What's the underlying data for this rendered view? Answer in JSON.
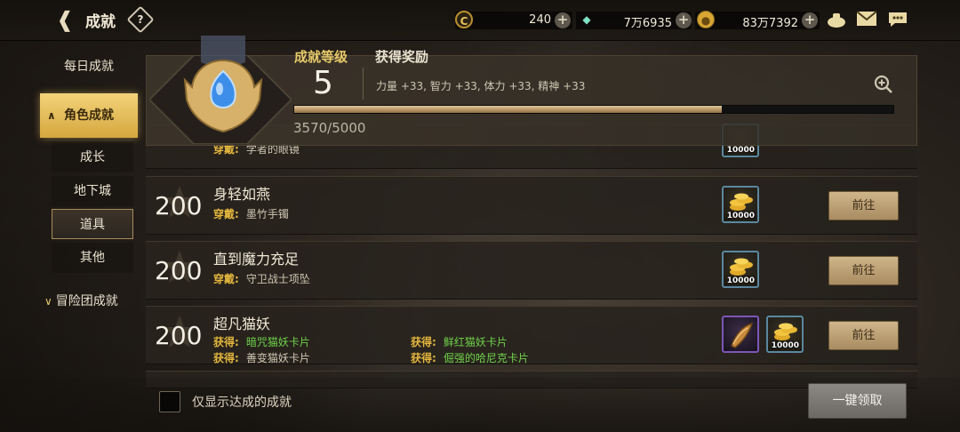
{
  "header": {
    "title": "成就",
    "help_glyph": "?"
  },
  "currencies": [
    {
      "icon": "c-coin-icon",
      "value": "240"
    },
    {
      "icon": "green-gem-icon",
      "value": "7万6935"
    },
    {
      "icon": "gold-coin-icon",
      "value": "83万7392"
    }
  ],
  "level": {
    "label": "成就等级",
    "value": "5",
    "reward_label": "获得奖励",
    "reward_text": "力量 +33, 智力 +33, 体力 +33, 精神 +33",
    "progress_text": "3570/5000",
    "progress_fraction": 0.714
  },
  "sidebar": {
    "daily": "每日成就",
    "character": "角色成就",
    "sub_items": [
      "成长",
      "地下城",
      "道具",
      "其他"
    ],
    "adventure": "冒险团成就"
  },
  "list": [
    {
      "points": "200",
      "name": "身轻如燕",
      "cond_label": "穿戴:",
      "cond_value": "墨竹手镯",
      "rewards": [
        {
          "qty": "10000",
          "type": "coins"
        }
      ],
      "button": "前往"
    },
    {
      "points": "200",
      "name": "直到魔力充足",
      "cond_label": "穿戴:",
      "cond_value": "守卫战士项坠",
      "rewards": [
        {
          "qty": "10000",
          "type": "coins"
        }
      ],
      "button": "前往"
    },
    {
      "points": "200",
      "name": "超凡猫妖",
      "cond_pairs": [
        {
          "label": "获得:",
          "value": "暗咒猫妖卡片",
          "done": true
        },
        {
          "label": "获得:",
          "value": "鲜红猫妖卡片",
          "done": true
        },
        {
          "label": "获得:",
          "value": "善变猫妖卡片",
          "done": false
        },
        {
          "label": "获得:",
          "value": "倔强的哈尼克卡片",
          "done": true
        }
      ],
      "rewards": [
        {
          "type": "horn"
        },
        {
          "qty": "10000",
          "type": "coins"
        }
      ],
      "button": "前往"
    }
  ],
  "partial_top": {
    "cond_label": "穿戴:",
    "cond_value": "学者的眼镜",
    "qty": "10000"
  },
  "footer": {
    "checkbox_label": "仅显示达成的成就",
    "claim_all": "一键领取"
  },
  "colors": {
    "accent_gold": "#e7c96a",
    "done_green": "#6fd24a"
  }
}
